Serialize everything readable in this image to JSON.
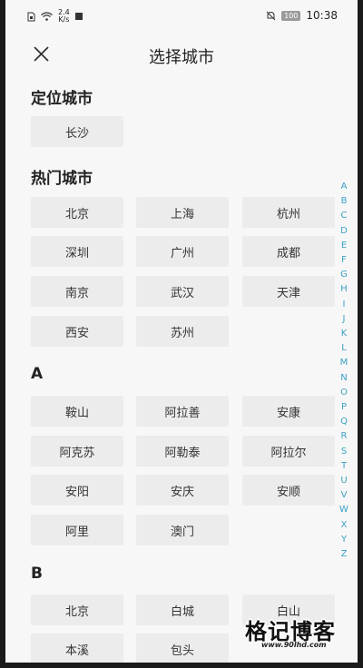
{
  "status_bar": {
    "speed_value": "2.4",
    "speed_unit": "K/s",
    "battery": "100",
    "time": "10:38",
    "icons": [
      "sim-icon",
      "wifi-icon",
      "notification-square-icon",
      "mute-bell-icon",
      "battery-icon"
    ]
  },
  "header": {
    "title": "选择城市",
    "close_icon": "close-icon"
  },
  "sections": {
    "location": {
      "title": "定位城市",
      "cities": [
        "长沙"
      ]
    },
    "hot": {
      "title": "热门城市",
      "cities": [
        "北京",
        "上海",
        "杭州",
        "深圳",
        "广州",
        "成都",
        "南京",
        "武汉",
        "天津",
        "西安",
        "苏州"
      ]
    },
    "a": {
      "title": "A",
      "cities": [
        "鞍山",
        "阿拉善",
        "安康",
        "阿克苏",
        "阿勒泰",
        "阿拉尔",
        "安阳",
        "安庆",
        "安顺",
        "阿里",
        "澳门"
      ]
    },
    "b": {
      "title": "B",
      "cities": [
        "北京",
        "白城",
        "白山",
        "本溪",
        "包头"
      ]
    }
  },
  "index_letters": [
    "A",
    "B",
    "C",
    "D",
    "E",
    "F",
    "G",
    "H",
    "I",
    "J",
    "K",
    "L",
    "M",
    "N",
    "O",
    "P",
    "Q",
    "R",
    "S",
    "T",
    "U",
    "V",
    "W",
    "X",
    "Y",
    "Z"
  ],
  "watermark": {
    "text": "格记博客",
    "url": "www.90lhd.com"
  },
  "colors": {
    "background": "#f7f7f7",
    "chip": "#ececec",
    "index_accent": "#3aa0c4",
    "text": "#222222"
  }
}
